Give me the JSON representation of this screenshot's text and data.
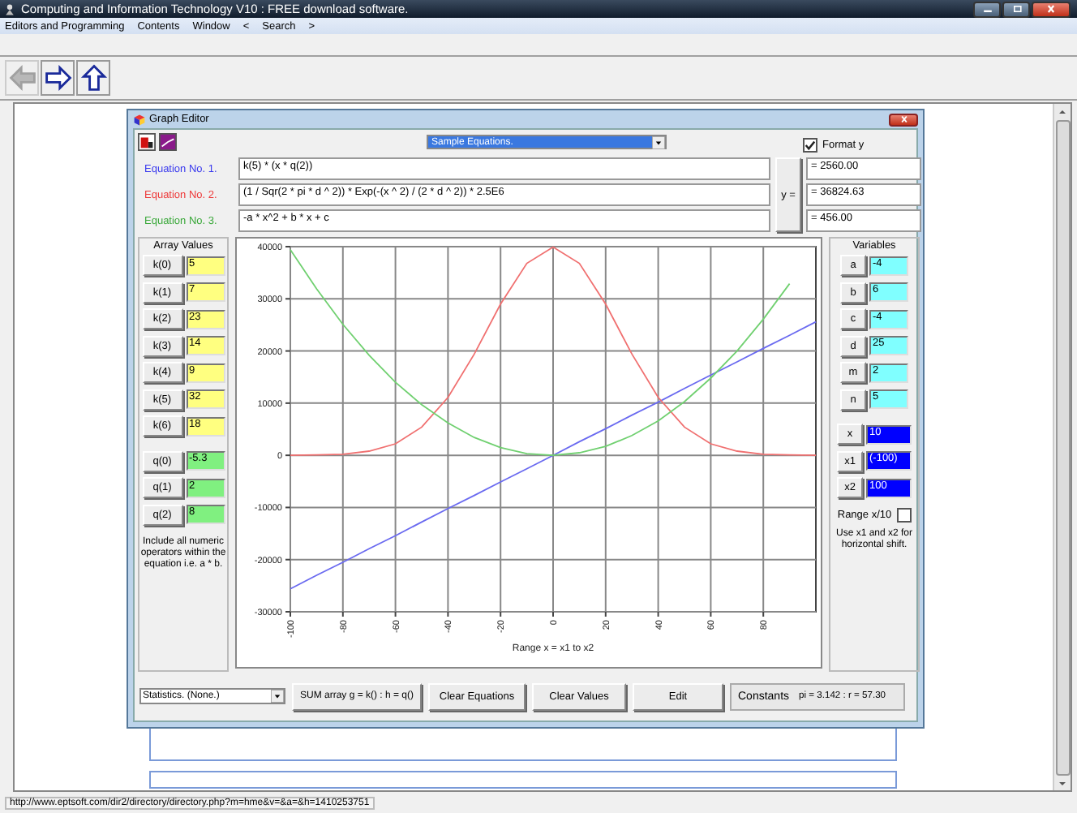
{
  "window": {
    "title": "Computing and Information Technology V10 : FREE download software."
  },
  "menu": [
    "Editors and Programming",
    "Contents",
    "Window",
    "<",
    "Search",
    ">"
  ],
  "nav_buttons": [
    {
      "kind": "back",
      "disabled": true
    },
    {
      "kind": "forward",
      "disabled": false
    },
    {
      "kind": "up",
      "disabled": false
    }
  ],
  "graph_editor": {
    "title": "Graph Editor",
    "sample_select": "Sample Equations.",
    "format_y": {
      "label": "Format y",
      "checked": true
    },
    "equations": [
      {
        "label": "Equation No. 1.",
        "color": "#3a3aee",
        "formula": "k(5) * (x * q(2))",
        "result": "= 2560.00"
      },
      {
        "label": "Equation No. 2.",
        "color": "#ee3a3a",
        "formula": "(1 / Sqr(2 * pi * d ^ 2)) * Exp(-(x ^ 2) / (2 * d ^ 2)) * 2.5E6",
        "result": "= 36824.63"
      },
      {
        "label": "Equation No. 3.",
        "color": "#3aa83a",
        "formula": "-a * x^2 + b * x + c",
        "result": "= 456.00"
      }
    ],
    "y_button": "y =",
    "array_values": {
      "title": "Array Values",
      "items": [
        {
          "name": "k(0)",
          "value": "5",
          "kind": "k"
        },
        {
          "name": "k(1)",
          "value": "7",
          "kind": "k"
        },
        {
          "name": "k(2)",
          "value": "23",
          "kind": "k"
        },
        {
          "name": "k(3)",
          "value": "14",
          "kind": "k"
        },
        {
          "name": "k(4)",
          "value": "9",
          "kind": "k"
        },
        {
          "name": "k(5)",
          "value": "32",
          "kind": "k"
        },
        {
          "name": "k(6)",
          "value": "18",
          "kind": "k"
        },
        {
          "name": "q(0)",
          "value": "-5.3",
          "kind": "q"
        },
        {
          "name": "q(1)",
          "value": "2",
          "kind": "q"
        },
        {
          "name": "q(2)",
          "value": "8",
          "kind": "q"
        }
      ],
      "note": "Include all numeric operators within the equation i.e. a * b."
    },
    "variables": {
      "title": "Variables",
      "items": [
        {
          "name": "a",
          "value": "-4",
          "kind": "constant"
        },
        {
          "name": "b",
          "value": "6",
          "kind": "constant"
        },
        {
          "name": "c",
          "value": "-4",
          "kind": "constant"
        },
        {
          "name": "d",
          "value": "25",
          "kind": "constant"
        },
        {
          "name": "m",
          "value": "2",
          "kind": "constant"
        },
        {
          "name": "n",
          "value": "5",
          "kind": "constant"
        },
        {
          "name": "x",
          "value": "10",
          "kind": "range"
        },
        {
          "name": "x1",
          "value": "(-100)",
          "kind": "range"
        },
        {
          "name": "x2",
          "value": "100",
          "kind": "range"
        }
      ],
      "range_x10": {
        "label": "Range x/10",
        "checked": false
      },
      "note": "Use x1 and x2 for horizontal shift."
    },
    "chart": {
      "chart_data": {
        "type": "line",
        "xlabel": "Range x = x1 to x2",
        "x": [
          -100,
          -90,
          -80,
          -70,
          -60,
          -50,
          -40,
          -30,
          -20,
          -10,
          0,
          10,
          20,
          30,
          40,
          50,
          60,
          70,
          80,
          90,
          100
        ],
        "series": [
          {
            "color": "#6a6af0",
            "values": [
              -25600,
              -23000,
              -20500,
              -17900,
              -15400,
              -12800,
              -10200,
              -7700,
              -5100,
              -2600,
              0,
              2600,
              5100,
              7700,
              10200,
              12800,
              15400,
              17900,
              20500,
              23000,
              25600
            ]
          },
          {
            "color": "#f07070",
            "values": [
              0,
              100,
              200,
              800,
              2200,
              5400,
              11100,
              19400,
              29000,
              36800,
              39900,
              36800,
              29000,
              19400,
              11100,
              5400,
              2200,
              800,
              200,
              100,
              0
            ]
          },
          {
            "color": "#70d070",
            "values": [
              39400,
              31900,
              25100,
              19200,
              14000,
              9700,
              6200,
              3400,
              1500,
              300,
              0,
              500,
              1700,
              3800,
              6600,
              10300,
              14800,
              20000,
              26100,
              32900,
              null
            ]
          }
        ],
        "grid": true,
        "xlim": [
          -100,
          100
        ],
        "ylim": [
          -30000,
          40000
        ],
        "xticks": [
          -100,
          -80,
          -60,
          -40,
          -20,
          0,
          20,
          40,
          60,
          80
        ],
        "yticks": [
          -30000,
          -20000,
          -10000,
          0,
          10000,
          20000,
          30000,
          40000
        ]
      }
    },
    "statistics_select": "Statistics. (None.)",
    "buttons": [
      "SUM array g = k() : h = q()",
      "Clear Equations",
      "Clear Values",
      "Edit"
    ],
    "constants": {
      "label": "Constants",
      "value": "pi = 3.142 : r = 57.30"
    }
  },
  "status_bar": "http://www.eptsoft.com/dir2/directory/directory.php?m=hme&v=&a=&h=1410253751"
}
